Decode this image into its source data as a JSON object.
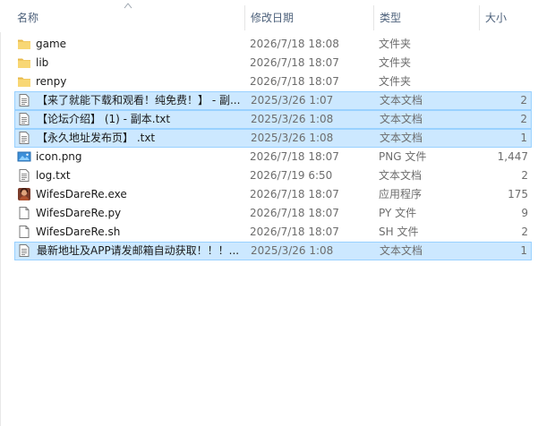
{
  "columns": {
    "name": "名称",
    "date": "修改日期",
    "type": "类型",
    "size": "大小"
  },
  "files": [
    {
      "name": "game",
      "date": "2026/7/18 18:08",
      "type": "文件夹",
      "size": "",
      "icon": "folder-icon",
      "selected": false
    },
    {
      "name": "lib",
      "date": "2026/7/18 18:07",
      "type": "文件夹",
      "size": "",
      "icon": "folder-icon",
      "selected": false
    },
    {
      "name": "renpy",
      "date": "2026/7/18 18:07",
      "type": "文件夹",
      "size": "",
      "icon": "folder-icon",
      "selected": false
    },
    {
      "name": "【来了就能下载和观看！纯免费！】 - 副...",
      "date": "2025/3/26 1:07",
      "type": "文本文档",
      "size": "2",
      "icon": "text-file-icon",
      "selected": true
    },
    {
      "name": "【论坛介绍】 (1) - 副本.txt",
      "date": "2025/3/26 1:08",
      "type": "文本文档",
      "size": "2",
      "icon": "text-file-icon",
      "selected": true
    },
    {
      "name": "【永久地址发布页】 .txt",
      "date": "2025/3/26 1:08",
      "type": "文本文档",
      "size": "1",
      "icon": "text-file-icon",
      "selected": true
    },
    {
      "name": "icon.png",
      "date": "2026/7/18 18:07",
      "type": "PNG 文件",
      "size": "1,447",
      "icon": "image-file-icon",
      "selected": false
    },
    {
      "name": "log.txt",
      "date": "2026/7/19 6:50",
      "type": "文本文档",
      "size": "2",
      "icon": "text-file-icon",
      "selected": false
    },
    {
      "name": "WifesDareRe.exe",
      "date": "2026/7/18 18:07",
      "type": "应用程序",
      "size": "175",
      "icon": "app-icon",
      "selected": false
    },
    {
      "name": "WifesDareRe.py",
      "date": "2026/7/18 18:07",
      "type": "PY 文件",
      "size": "9",
      "icon": "blank-file-icon",
      "selected": false
    },
    {
      "name": "WifesDareRe.sh",
      "date": "2026/7/18 18:07",
      "type": "SH 文件",
      "size": "2",
      "icon": "blank-file-icon",
      "selected": false
    },
    {
      "name": "最新地址及APP请发邮箱自动获取！！！...",
      "date": "2025/3/26 1:08",
      "type": "文本文档",
      "size": "1",
      "icon": "text-file-icon",
      "selected": true
    }
  ],
  "colors": {
    "selection_bg": "#cce8ff",
    "selection_border": "#99d1ff",
    "header_text": "#4c607a",
    "folder": "#f8d775"
  }
}
